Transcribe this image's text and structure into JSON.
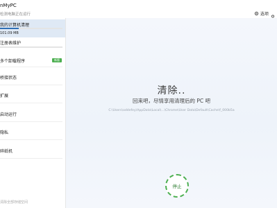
{
  "app": {
    "title": "nMyPC",
    "subtitle": "检测电脑正在运行"
  },
  "header": {
    "settings_label": "选项"
  },
  "sidebar": {
    "items": [
      {
        "label": "我的计算机清理",
        "sub": "101.09 MB",
        "progress": 0.3
      },
      {
        "label": "注册表维护",
        "progress": 0.0
      },
      {
        "label": "多个卸载程序",
        "badge": "新版"
      },
      {
        "label": "桥接状态"
      },
      {
        "label": "扩展"
      },
      {
        "label": "启动运行"
      },
      {
        "label": "隐私"
      },
      {
        "label": "碎纸机"
      }
    ],
    "footer": "清除全部存储空间"
  },
  "main": {
    "title": "清除..",
    "subtitle": "回来吧，尽情享用清理后的 PC 吧",
    "path": "C:\\Users\\oddefey\\AppData\\Local\\...\\Chrome\\User Data\\Default\\Cache\\f_000b5a",
    "stop_label": "停止"
  },
  "colors": {
    "accent": "#2f6fb5",
    "badge": "#4caf50",
    "stop_ring": "#4caf50"
  }
}
